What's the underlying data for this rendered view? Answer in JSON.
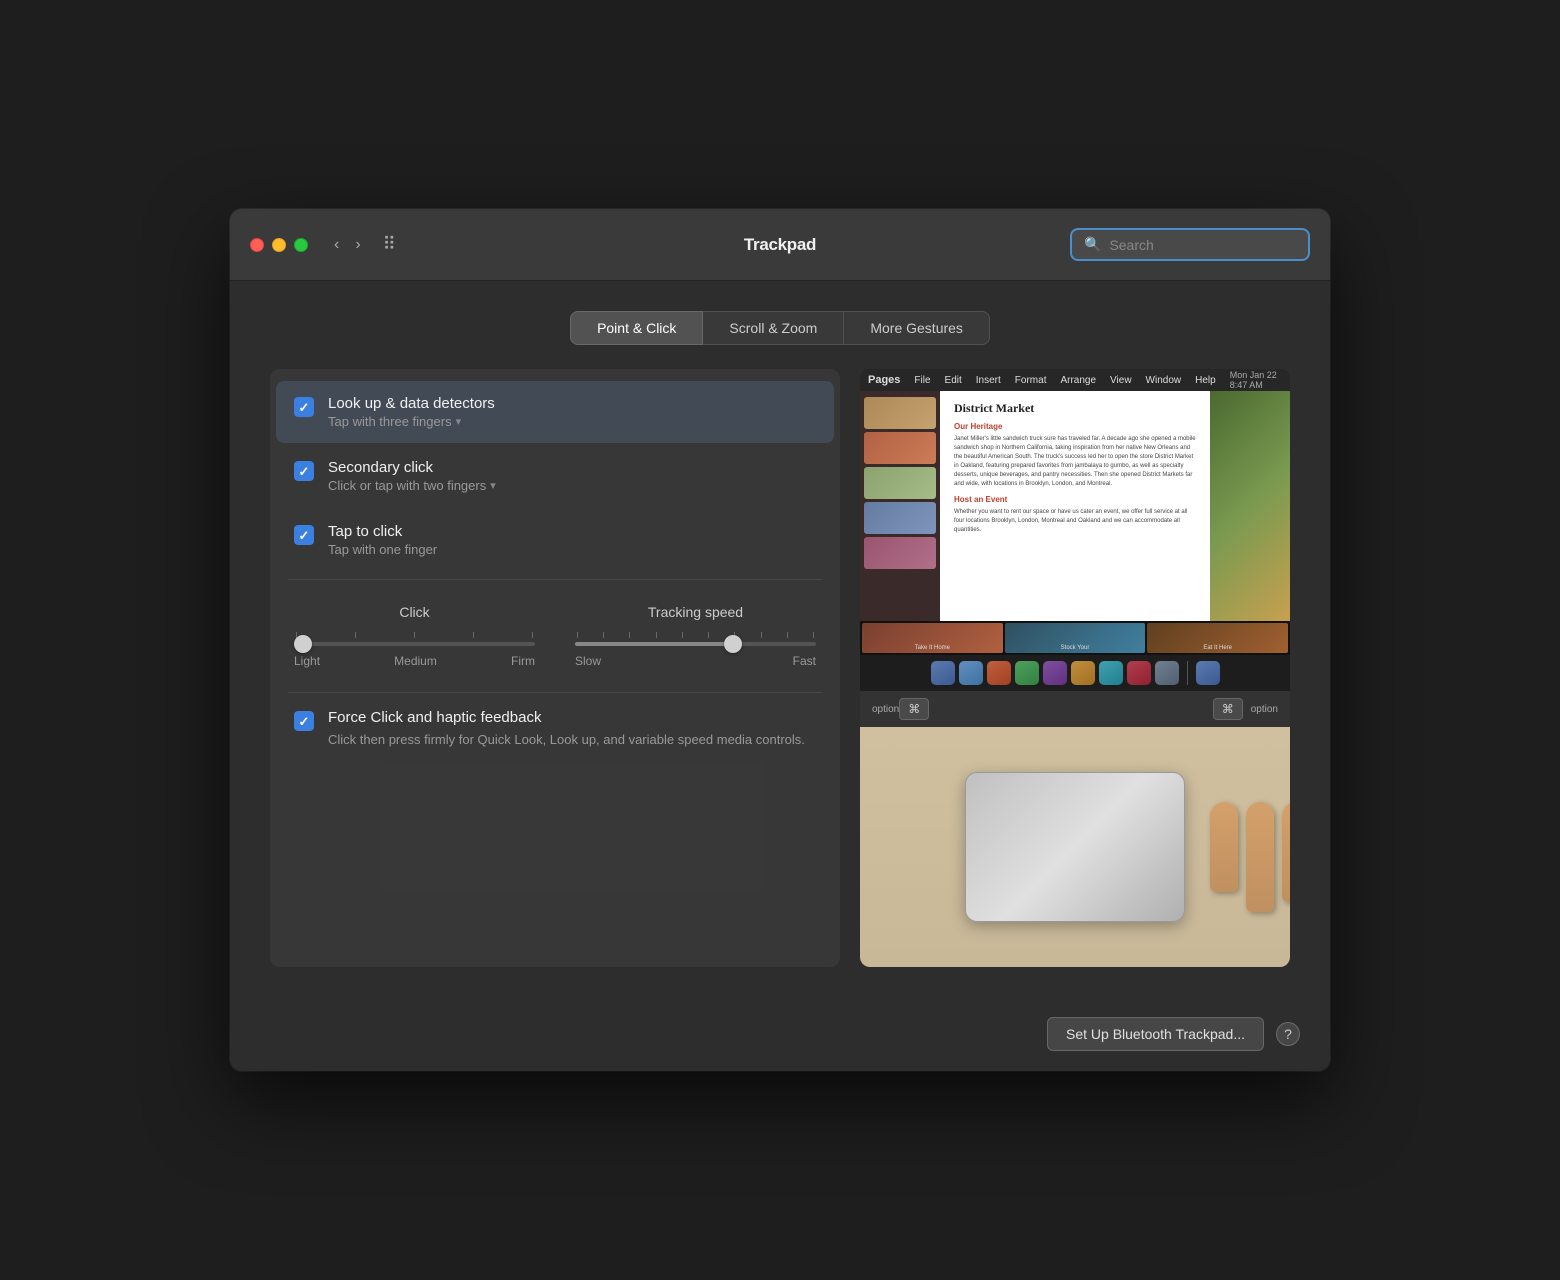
{
  "window": {
    "title": "Trackpad",
    "search_placeholder": "Search"
  },
  "tabs": [
    {
      "id": "point-click",
      "label": "Point & Click",
      "active": true
    },
    {
      "id": "scroll-zoom",
      "label": "Scroll & Zoom",
      "active": false
    },
    {
      "id": "more-gestures",
      "label": "More Gestures",
      "active": false
    }
  ],
  "options": [
    {
      "id": "look-up",
      "label": "Look up & data detectors",
      "subtitle": "Tap with three fingers",
      "checked": true,
      "selected": true
    },
    {
      "id": "secondary-click",
      "label": "Secondary click",
      "subtitle": "Click or tap with two fingers",
      "checked": true,
      "selected": false
    },
    {
      "id": "tap-to-click",
      "label": "Tap to click",
      "subtitle": "Tap with one finger",
      "checked": true,
      "selected": false
    }
  ],
  "sliders": {
    "click": {
      "title": "Click",
      "labels": [
        "Light",
        "Medium",
        "Firm"
      ],
      "value": 0
    },
    "tracking_speed": {
      "title": "Tracking speed",
      "labels": [
        "Slow",
        "Fast"
      ],
      "value": 65
    }
  },
  "force_click": {
    "label": "Force Click and haptic feedback",
    "description": "Click then press firmly for Quick Look, Look up, and variable speed media controls.",
    "checked": true
  },
  "doc_preview": {
    "title": "District Market",
    "subtitle": "Our Heritage",
    "body": "Janet Miller's little sandwich truck sure has traveled far. A decade ago she opened a mobile sandwich shop in Northern California, taking inspiration from her native New Orleans and the beautiful American South. The truck's success led her to open the store District Market in Oakland, featuring prepared favorites from jambalaya to gumbo, as well as specialty desserts, unique beverages, and pantry necessities. Then she opened District Markets far and wide, with locations in Brooklyn, London, and Montreal.",
    "host_title": "Host an Event",
    "host_body": "Whether you want to rent our space or have us cater an event, we offer full service at all four locations Brooklyn, London, Montreal and Oakland and we can accommodate all quantities."
  },
  "bottom_bar": {
    "setup_button": "Set Up Bluetooth Trackpad...",
    "help_label": "?"
  }
}
